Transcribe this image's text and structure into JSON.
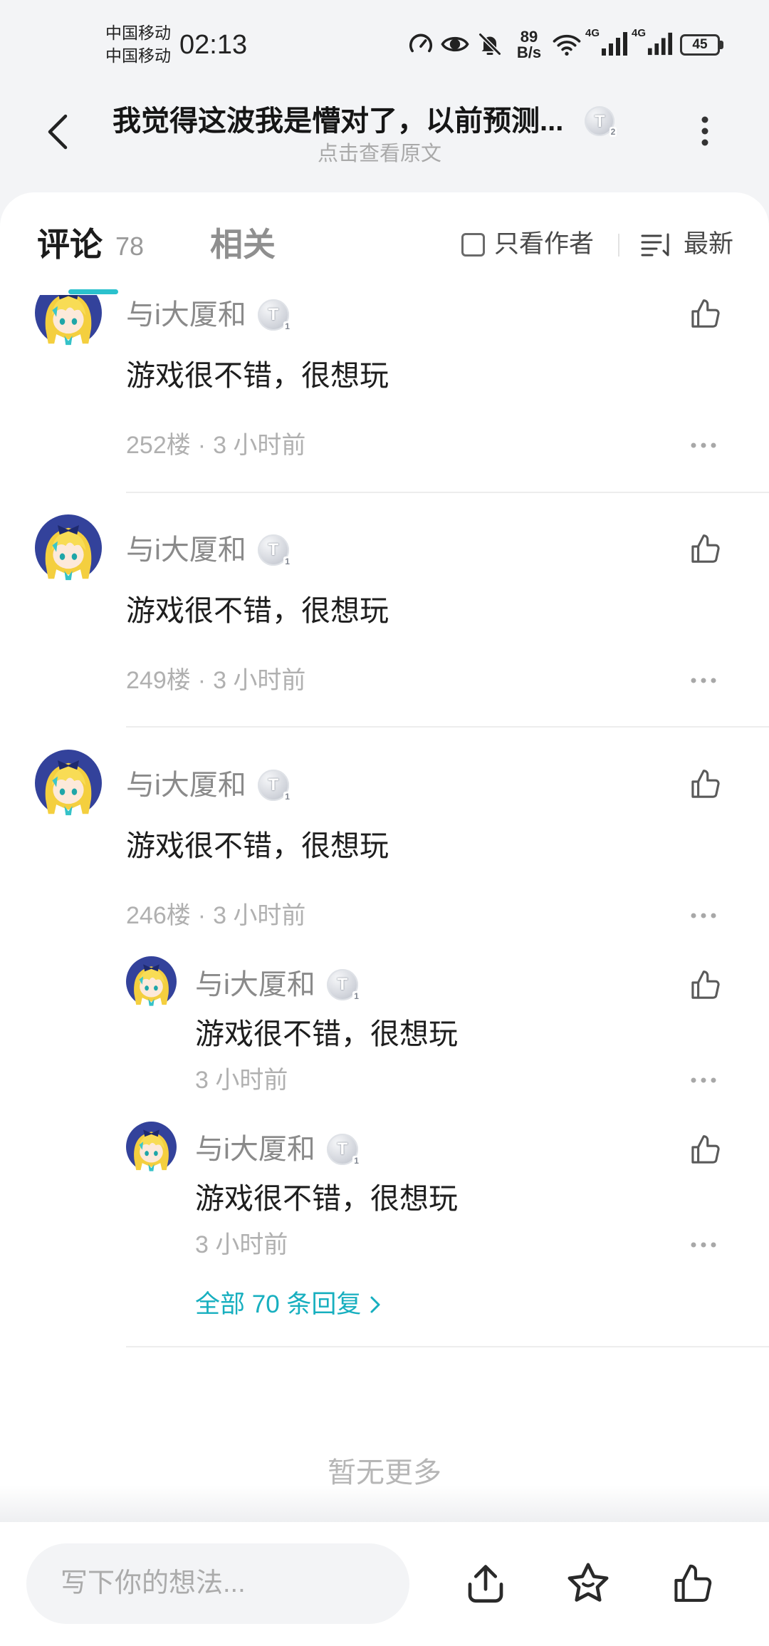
{
  "status_bar": {
    "carrier_1": "中国移动",
    "carrier_2": "中国移动",
    "time": "02:13",
    "net_speed_value": "89",
    "net_speed_unit": "B/s",
    "sim_1_network": "4G",
    "sim_2_network": "4G",
    "battery_level": "45",
    "icons": [
      "speedometer-icon",
      "eye-icon",
      "bell-off-icon",
      "wifi-icon",
      "signal-icon",
      "signal-icon",
      "battery-icon"
    ]
  },
  "header": {
    "back_icon": "back-arrow-icon",
    "title": "我觉得这波我是懵对了，以前预测...",
    "title_badge": {
      "letter": "T",
      "level": "2"
    },
    "subtitle": "点击查看原文",
    "more_icon": "more-vertical-icon"
  },
  "tabs": [
    {
      "label": "评论",
      "count": "78",
      "active": true
    },
    {
      "label": "相关",
      "active": false
    }
  ],
  "filters": {
    "author_only_label": "只看作者",
    "author_only_checked": false,
    "sort_icon": "sort-icon",
    "sort_label": "最新"
  },
  "meta_separator": "·",
  "comments": [
    {
      "user": "与i大厦和",
      "badge": {
        "letter": "T",
        "level": "1"
      },
      "content": "游戏很不错，很想玩",
      "floor": "252楼",
      "time": "3 小时前"
    },
    {
      "user": "与i大厦和",
      "badge": {
        "letter": "T",
        "level": "1"
      },
      "content": "游戏很不错，很想玩",
      "floor": "249楼",
      "time": "3 小时前"
    },
    {
      "user": "与i大厦和",
      "badge": {
        "letter": "T",
        "level": "1"
      },
      "content": "游戏很不错，很想玩",
      "floor": "246楼",
      "time": "3 小时前",
      "replies": [
        {
          "user": "与i大厦和",
          "badge": {
            "letter": "T",
            "level": "1"
          },
          "content": "游戏很不错，很想玩",
          "time": "3 小时前"
        },
        {
          "user": "与i大厦和",
          "badge": {
            "letter": "T",
            "level": "1"
          },
          "content": "游戏很不错，很想玩",
          "time": "3 小时前"
        }
      ],
      "all_replies_label": "全部 70 条回复"
    }
  ],
  "end_of_list": "暂无更多",
  "composer": {
    "placeholder": "写下你的想法...",
    "actions": [
      "share-icon",
      "star-icon",
      "thumbs-up-icon"
    ]
  },
  "colors": {
    "page_bg": "#f3f4f6",
    "card_bg": "#ffffff",
    "accent": "#2bc1cd",
    "link": "#17afbf",
    "username": "#8a8a8a",
    "meta": "#b0b0b0",
    "avatar_bg": "#33429b",
    "avatar_hair": "#f4cf3f"
  }
}
